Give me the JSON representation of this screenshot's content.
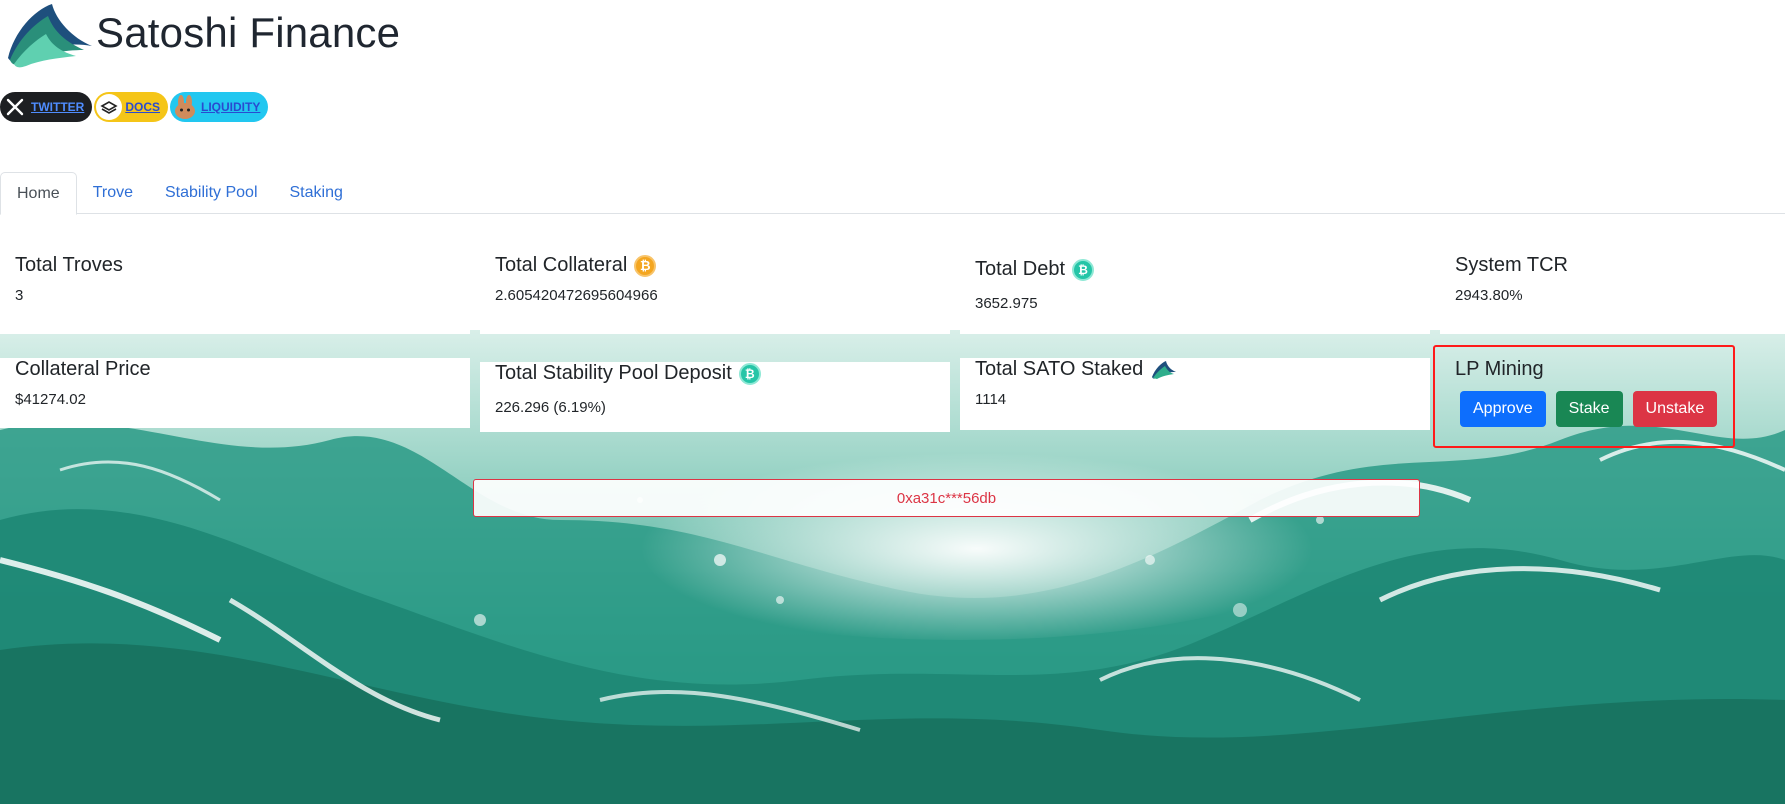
{
  "brand": {
    "name": "Satoshi Finance"
  },
  "social": {
    "twitter_label": "TWITTER",
    "docs_label": "DOCS",
    "liquidity_label": "LIQUIDITY"
  },
  "tabs": [
    {
      "label": "Home",
      "active": true
    },
    {
      "label": "Trove",
      "active": false
    },
    {
      "label": "Stability Pool",
      "active": false
    },
    {
      "label": "Staking",
      "active": false
    }
  ],
  "stats": {
    "total_troves": {
      "title": "Total Troves",
      "value": "3"
    },
    "total_collateral": {
      "title": "Total Collateral",
      "value": "2.605420472695604966",
      "icon": "bitcoin-coin-icon"
    },
    "total_debt": {
      "title": "Total Debt",
      "value": "3652.975",
      "icon": "sat-stablecoin-icon"
    },
    "system_tcr": {
      "title": "System TCR",
      "value": "2943.80%"
    },
    "collateral_price": {
      "title": "Collateral Price",
      "value": "$41274.02"
    },
    "stability_pool_deposit": {
      "title": "Total Stability Pool Deposit",
      "value": "226.296 (6.19%)",
      "icon": "sat-stablecoin-icon"
    },
    "sato_staked": {
      "title": "Total SATO Staked",
      "value": "1114",
      "icon": "sato-logo-icon"
    }
  },
  "lp_mining": {
    "title": "LP Mining",
    "approve_label": "Approve",
    "stake_label": "Stake",
    "unstake_label": "Unstake"
  },
  "wallet": {
    "address": "0xa31c***56db"
  },
  "colors": {
    "tab_link": "#2f6fd6",
    "approve": "#0d6efd",
    "stake": "#198754",
    "unstake": "#dc3545",
    "highlight_box": "#ff1a1a",
    "ocean": "#2a9a86"
  }
}
